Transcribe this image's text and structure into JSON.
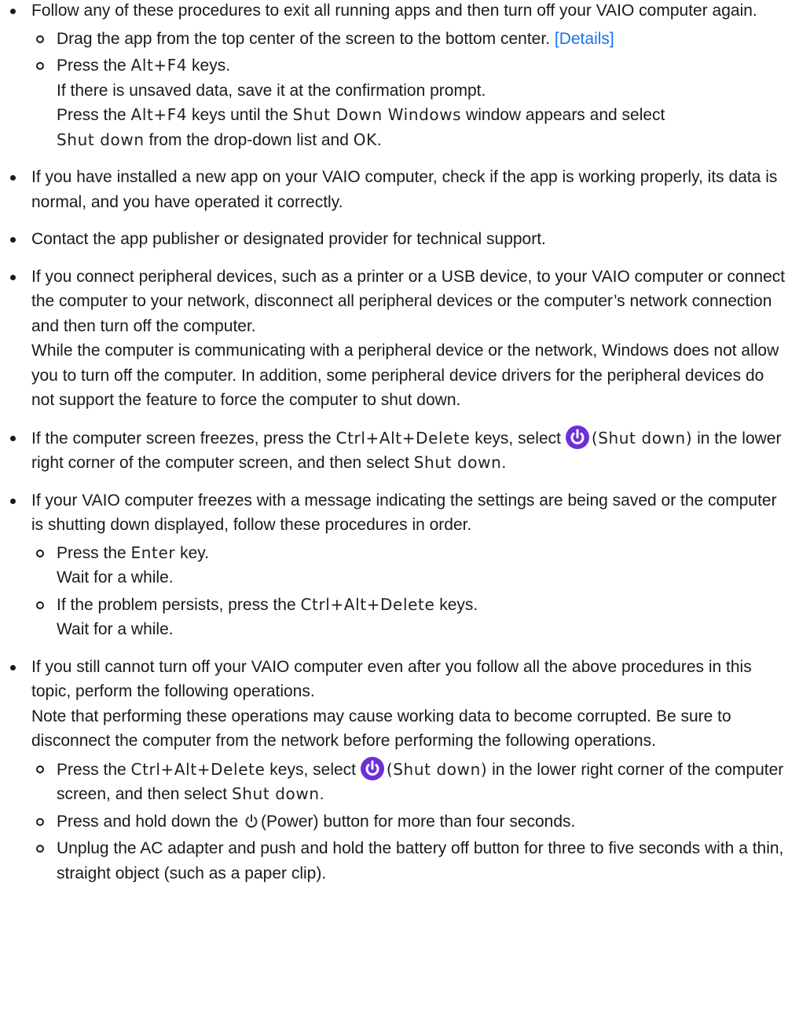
{
  "items": [
    {
      "text": "Follow any of these procedures to exit all running apps and then turn off your VAIO computer again.",
      "sub": [
        {
          "a": "Drag the app from the top center of the screen to the bottom center.",
          "link": "[Details]"
        },
        {
          "a": "Press the ",
          "k1": "Alt+F4",
          "b": " keys.",
          "c": "If there is unsaved data, save it at the confirmation prompt.",
          "d": "Press the ",
          "k2": "Alt+F4",
          "e": " keys until the ",
          "k3": "Shut Down Windows",
          "f": " window appears and select ",
          "k4": "Shut down",
          "g": " from the drop-down list and ",
          "k5": "OK",
          "h": "."
        }
      ]
    },
    {
      "text": "If you have installed a new app on your VAIO computer, check if the app is working properly, its data is normal, and you have operated it correctly."
    },
    {
      "text": "Contact the app publisher or designated provider for technical support."
    },
    {
      "text": "If you connect peripheral devices, such as a printer or a USB device, to your VAIO computer or connect the computer to your network, disconnect all peripheral devices or the computer’s network connection and then turn off the computer.",
      "text2": "While the computer is communicating with a peripheral device or the network, Windows does not allow you to turn off the computer. In addition, some peripheral device drivers for the peripheral devices do not support the feature to force the computer to shut down."
    },
    {
      "a": "If the computer screen freezes, press the ",
      "k1": "Ctrl+Alt+Delete",
      "b": " keys, select ",
      "k2": "(Shut down)",
      "c": " in the lower right corner of the computer screen, and then select ",
      "k3": "Shut down",
      "d": "."
    },
    {
      "text": "If your VAIO computer freezes with a message indicating the settings are being saved or the computer is shutting down displayed, follow these procedures in order.",
      "sub": [
        {
          "a": "Press the ",
          "k1": "Enter",
          "b": " key.",
          "c": "Wait for a while."
        },
        {
          "a": "If the problem persists, press the ",
          "k1": "Ctrl+Alt+Delete",
          "b": " keys.",
          "c": "Wait for a while."
        }
      ]
    },
    {
      "text": "If you still cannot turn off your VAIO computer even after you follow all the above procedures in this topic, perform the following operations.",
      "text2": "Note that performing these operations may cause working data to become corrupted. Be sure to disconnect the computer from the network before performing the following operations.",
      "sub": [
        {
          "a": "Press the ",
          "k1": "Ctrl+Alt+Delete",
          "b": " keys, select ",
          "k2": "(Shut down)",
          "c": " in the lower right corner of the computer screen, and then select ",
          "k3": "Shut down",
          "d": "."
        },
        {
          "a": "Press and hold down the ",
          "b": "(Power) button for more than four seconds."
        },
        {
          "a": "Unplug the AC adapter and push and hold the battery off button for three to five seconds with a thin, straight object (such as a paper clip)."
        }
      ]
    }
  ],
  "colors": {
    "link": "#1a73e8",
    "shutdown_icon_bg": "#6d2fd6"
  },
  "icons": {
    "shutdown": "shutdown-icon",
    "power": "power-icon"
  }
}
